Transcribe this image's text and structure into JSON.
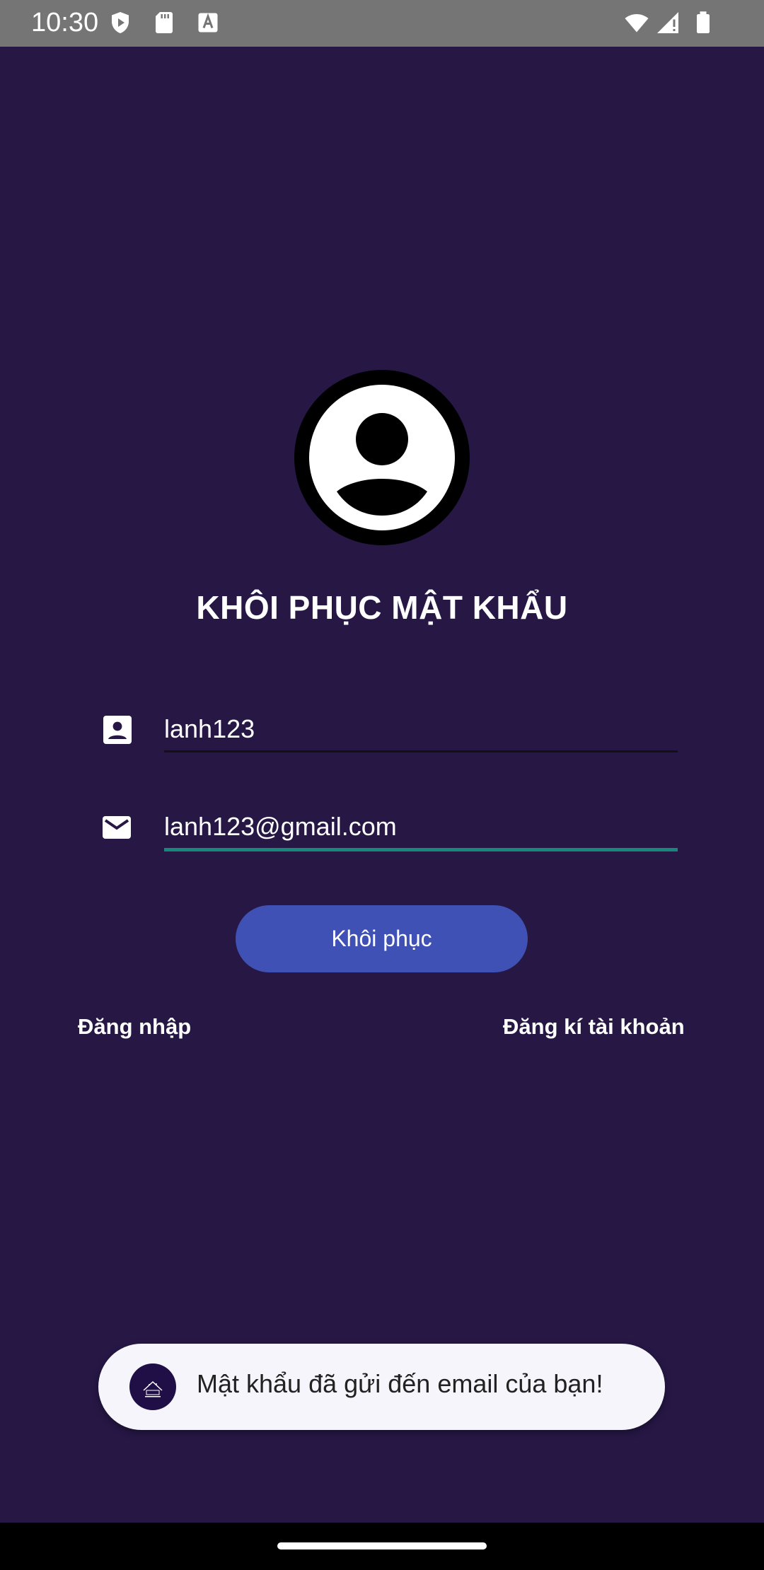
{
  "status_bar": {
    "time": "10:30",
    "icons_left": [
      "shield-play-icon",
      "sd-card-icon",
      "font-a-icon"
    ],
    "icons_right": [
      "wifi-icon",
      "signal-icon",
      "battery-icon"
    ]
  },
  "header": {
    "title": "KHÔI PHỤC MẬT KHẨU"
  },
  "form": {
    "username": {
      "icon": "contact-card-icon",
      "value": "lanh123"
    },
    "email": {
      "icon": "mail-icon",
      "value": "lanh123@gmail.com"
    },
    "submit_label": "Khôi phục"
  },
  "links": {
    "login": "Đăng nhập",
    "register": "Đăng kí tài khoản"
  },
  "toast": {
    "message": "Mật khẩu đã gửi đến email của bạn!"
  },
  "colors": {
    "background": "#261745",
    "status_bar": "#757575",
    "button": "#3f51b5",
    "focused_underline": "#17877c",
    "toast_bg": "#f5f5fb"
  }
}
